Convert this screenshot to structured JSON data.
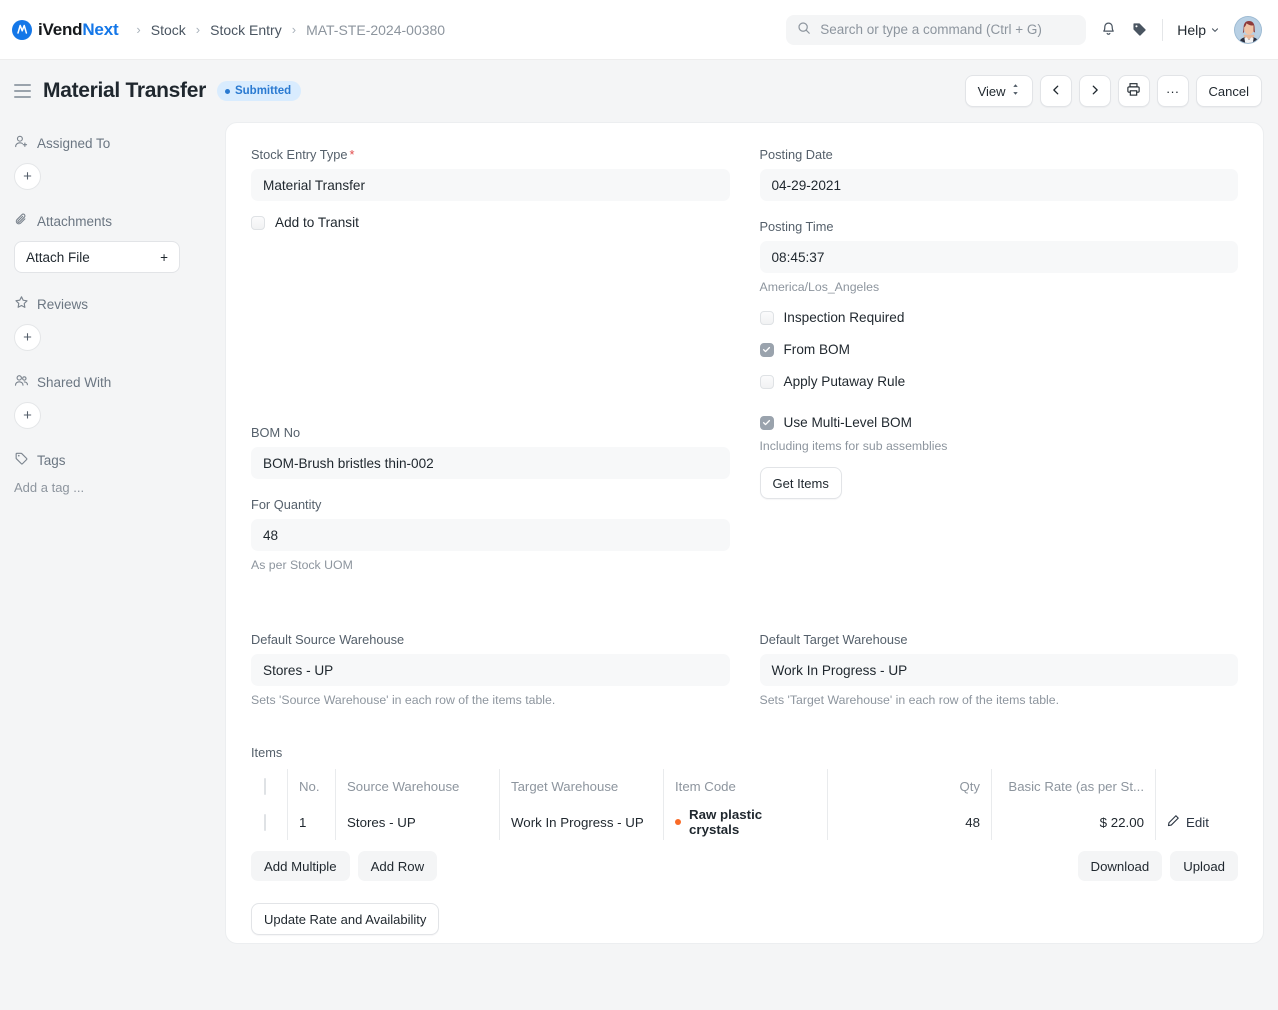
{
  "navbar": {
    "brand_part1": "iVend",
    "brand_part2": "Next",
    "breadcrumbs": [
      {
        "label": "Stock"
      },
      {
        "label": "Stock Entry"
      },
      {
        "label": "MAT-STE-2024-00380"
      }
    ],
    "separator": "›",
    "search_placeholder": "Search or type a command (Ctrl + G)",
    "help_label": "Help",
    "icons": {
      "search": "search-icon",
      "bell": "notifications-icon",
      "tag": "tag-icon",
      "chevron": "chevron-down-icon",
      "avatar": "user-avatar"
    }
  },
  "page_header": {
    "title": "Material Transfer",
    "status": "Submitted",
    "status_color": "#2a7ad1",
    "actions": {
      "view": "View",
      "prev": "‹",
      "next": "›",
      "print": "print-icon",
      "more": "···",
      "cancel": "Cancel"
    }
  },
  "sidebar": {
    "sections": [
      {
        "label": "Assigned To",
        "icon": "assign-user-icon",
        "control": "add"
      },
      {
        "label": "Attachments",
        "icon": "paperclip-icon",
        "control": "attach",
        "attach_label": "Attach File"
      },
      {
        "label": "Reviews",
        "icon": "star-icon",
        "control": "add"
      },
      {
        "label": "Shared With",
        "icon": "users-icon",
        "control": "add"
      },
      {
        "label": "Tags",
        "icon": "tag-icon",
        "control": "tag",
        "tag_placeholder": "Add a tag ..."
      }
    ],
    "plus": "+"
  },
  "form": {
    "stock_entry_type": {
      "label": "Stock Entry Type",
      "required": true,
      "value": "Material Transfer"
    },
    "add_to_transit": {
      "label": "Add to Transit",
      "checked": false
    },
    "bom_no": {
      "label": "BOM No",
      "value": "BOM-Brush bristles thin-002"
    },
    "for_quantity": {
      "label": "For Quantity",
      "value": "48",
      "help": "As per Stock UOM"
    },
    "posting_date": {
      "label": "Posting Date",
      "value": "04-29-2021"
    },
    "posting_time": {
      "label": "Posting Time",
      "value": "08:45:37",
      "help": "America/Los_Angeles"
    },
    "inspection_required": {
      "label": "Inspection Required",
      "checked": false
    },
    "from_bom": {
      "label": "From BOM",
      "checked": true
    },
    "apply_putaway_rule": {
      "label": "Apply Putaway Rule",
      "checked": false
    },
    "use_multi_level_bom": {
      "label": "Use Multi-Level BOM",
      "checked": true,
      "help": "Including items for sub assemblies"
    },
    "get_items_button": "Get Items",
    "default_source_warehouse": {
      "label": "Default Source Warehouse",
      "value": "Stores - UP",
      "help": "Sets 'Source Warehouse' in each row of the items table."
    },
    "default_target_warehouse": {
      "label": "Default Target Warehouse",
      "value": "Work In Progress - UP",
      "help": "Sets 'Target Warehouse' in each row of the items table."
    }
  },
  "items": {
    "section_label": "Items",
    "columns": [
      "No.",
      "Source Warehouse",
      "Target Warehouse",
      "Item Code",
      "Qty",
      "Basic Rate (as per St...",
      ""
    ],
    "rows": [
      {
        "no": "1",
        "source_warehouse": "Stores - UP",
        "target_warehouse": "Work In Progress - UP",
        "item_code": "Raw plastic crystals",
        "item_dot_color": "#f96a27",
        "qty": "48",
        "basic_rate": "$ 22.00",
        "edit_label": "Edit"
      }
    ],
    "buttons": {
      "add_multiple": "Add Multiple",
      "add_row": "Add Row",
      "download": "Download",
      "upload": "Upload",
      "update_rate": "Update Rate and Availability"
    }
  }
}
